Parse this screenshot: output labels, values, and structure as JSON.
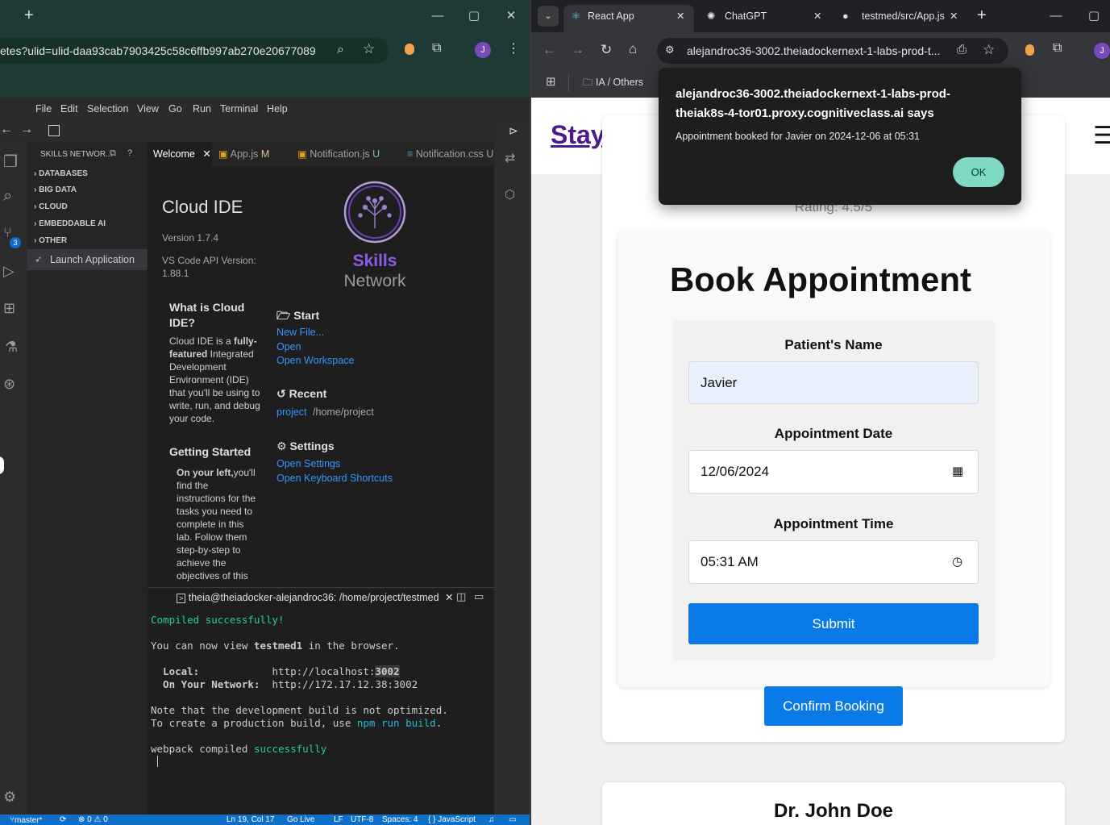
{
  "left_window": {
    "url": "etes?ulid=ulid-daa93cab7903425c58c6ffb997ab270e20677089",
    "profile_initial": "J",
    "menu": [
      "File",
      "Edit",
      "Selection",
      "View",
      "Go",
      "Run",
      "Terminal",
      "Help"
    ],
    "sidebar": {
      "title": "SKILLS NETWOR...",
      "sections": [
        "DATABASES",
        "BIG DATA",
        "CLOUD",
        "EMBEDDABLE AI",
        "OTHER"
      ],
      "launch_label": "Launch Application"
    },
    "source_control_badge": "3",
    "tabs": [
      {
        "label": "Welcome",
        "status": ""
      },
      {
        "label": "App.js",
        "status": "M"
      },
      {
        "label": "Notification.js",
        "status": "U"
      },
      {
        "label": "Notification.css",
        "status": "U"
      }
    ],
    "welcome": {
      "title": "Cloud IDE",
      "version": "Version 1.7.4",
      "api_version_label": "VS Code API Version:",
      "api_version": "1.88.1",
      "logo_line1": "Skills",
      "logo_line2": "Network",
      "what_heading": "What is Cloud IDE?",
      "what_text_a": "Cloud IDE is a ",
      "what_text_bold": "fully-featured",
      "what_text_b": " Integrated Development Environment (IDE) that you'll be using to write, run, and debug your code.",
      "getting_started_heading": "Getting Started",
      "getting_started_bold": "On your left,",
      "getting_started_text": "you'll find the instructions for the tasks you need to complete in this lab. Follow them step-by-step to achieve the objectives of this",
      "start_heading": "Start",
      "start_links": [
        "New File...",
        "Open",
        "Open Workspace"
      ],
      "recent_heading": "Recent",
      "recent_link": "project",
      "recent_path": "/home/project",
      "settings_heading": "Settings",
      "settings_links": [
        "Open Settings",
        "Open Keyboard Shortcuts"
      ]
    },
    "terminal": {
      "tab_title": "theia@theiadocker-alejandroc36: /home/project/testmed",
      "lines": {
        "compiled": "Compiled successfully!",
        "view_a": "You can now view ",
        "view_app": "testmed1",
        "view_b": " in the browser.",
        "local_label": "  Local:            ",
        "local_url_a": "http://localhost:",
        "local_port": "3002",
        "network_label": "  On Your Network:  ",
        "network_url": "http://172.17.12.38:3002",
        "note1": "Note that the development build is not optimized.",
        "note2_a": "To create a production build, use ",
        "note2_cmd": "npm run build",
        "note2_b": ".",
        "webpack_a": "webpack compiled ",
        "webpack_b": "successfully"
      }
    },
    "statusbar": {
      "branch": "master*",
      "problems": "⊗ 0 ⚠ 0",
      "position": "Ln 19, Col 17",
      "golive": "Go Live",
      "eol": "LF",
      "encoding": "UTF-8",
      "spaces": "Spaces: 4",
      "language": "{ } JavaScript"
    }
  },
  "right_window": {
    "tabs": [
      {
        "label": "React App",
        "active": true
      },
      {
        "label": "ChatGPT",
        "active": false
      },
      {
        "label": "testmed/src/App.js",
        "active": false
      }
    ],
    "url": "alejandroc36-3002.theiadockernext-1-labs-prod-t...",
    "bookmark_folder": "IA / Others",
    "profile_initial": "J",
    "page": {
      "brand_partial": "Stay",
      "rating": "Rating: 4.5/5",
      "form_title": "Book Appointment",
      "name_label": "Patient's Name",
      "name_value": "Javier",
      "date_label": "Appointment Date",
      "date_value": "12/06/2024",
      "time_label": "Appointment Time",
      "time_value": "05:31 AM",
      "submit_label": "Submit",
      "confirm_label": "Confirm Booking",
      "next_doctor": "Dr. John Doe"
    },
    "dialog": {
      "origin_line1": "alejandroc36-3002.theiadockernext-1-labs-prod-",
      "origin_line2": "theiak8s-4-tor01.proxy.cognitiveclass.ai says",
      "message": "Appointment booked for Javier on 2024-12-06 at 05:31",
      "ok_label": "OK"
    }
  },
  "colors": {
    "chrome_green": "#1f3a34",
    "vscode_blue": "#0e6fc6",
    "link_blue": "#3794ff",
    "submit_blue": "#0a7ae6",
    "ok_teal": "#7fd9c4",
    "brand_purple": "#4b1a8c"
  }
}
